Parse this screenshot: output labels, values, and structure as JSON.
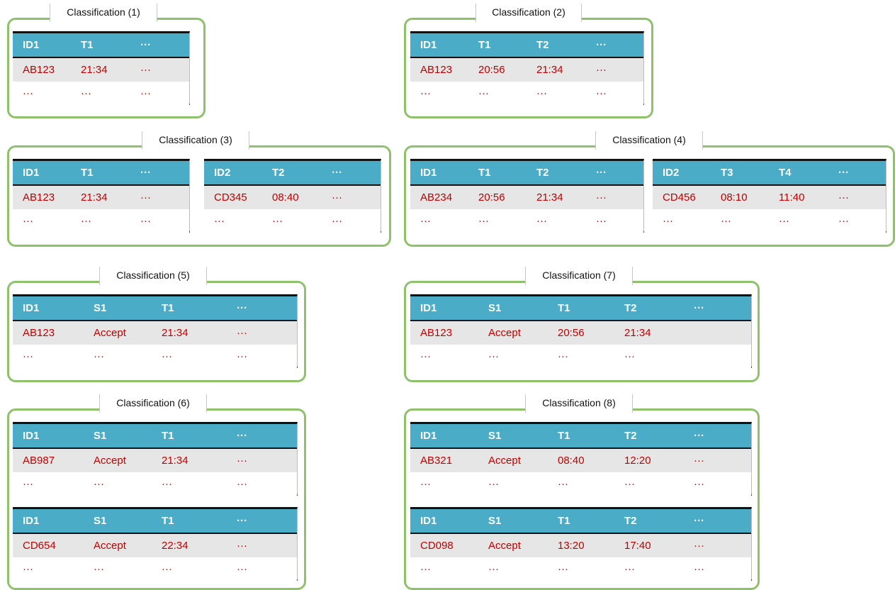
{
  "classifications": [
    {
      "title": "Classification (1)",
      "tables": [
        {
          "headers": [
            "ID1",
            "T1",
            "···"
          ],
          "rows": [
            [
              "AB123",
              "21:34",
              "···"
            ],
            [
              "···",
              "···",
              "···"
            ]
          ]
        }
      ]
    },
    {
      "title": "Classification (2)",
      "tables": [
        {
          "headers": [
            "ID1",
            "T1",
            "T2",
            "···"
          ],
          "rows": [
            [
              "AB123",
              "20:56",
              "21:34",
              "···"
            ],
            [
              "···",
              "···",
              "···",
              "···"
            ]
          ]
        }
      ]
    },
    {
      "title": "Classification (3)",
      "tables": [
        {
          "headers": [
            "ID1",
            "T1",
            "···"
          ],
          "rows": [
            [
              "AB123",
              "21:34",
              "···"
            ],
            [
              "···",
              "···",
              "···"
            ]
          ]
        },
        {
          "headers": [
            "ID2",
            "T2",
            "···"
          ],
          "rows": [
            [
              "CD345",
              "08:40",
              "···"
            ],
            [
              "···",
              "···",
              "···"
            ]
          ]
        }
      ]
    },
    {
      "title": "Classification (4)",
      "tables": [
        {
          "headers": [
            "ID1",
            "T1",
            "T2",
            "···"
          ],
          "rows": [
            [
              "AB234",
              "20:56",
              "21:34",
              "···"
            ],
            [
              "···",
              "···",
              "···",
              "···"
            ]
          ]
        },
        {
          "headers": [
            "ID2",
            "T3",
            "T4",
            "···"
          ],
          "rows": [
            [
              "CD456",
              "08:10",
              "11:40",
              "···"
            ],
            [
              "···",
              "···",
              "···",
              "···"
            ]
          ]
        }
      ]
    },
    {
      "title": "Classification (5)",
      "tables": [
        {
          "headers": [
            "ID1",
            "S1",
            "T1",
            "···"
          ],
          "rows": [
            [
              "AB123",
              "Accept",
              "21:34",
              "···"
            ],
            [
              "···",
              "···",
              "···",
              "···"
            ]
          ]
        }
      ]
    },
    {
      "title": "Classification (7)",
      "tables": [
        {
          "headers": [
            "ID1",
            "S1",
            "T1",
            "T2",
            "···"
          ],
          "rows": [
            [
              "AB123",
              "Accept",
              "20:56",
              "21:34",
              ""
            ],
            [
              "···",
              "···",
              "···",
              "···",
              ""
            ]
          ]
        }
      ]
    },
    {
      "title": "Classification (6)",
      "tables": [
        {
          "headers": [
            "ID1",
            "S1",
            "T1",
            "···"
          ],
          "rows": [
            [
              "AB987",
              "Accept",
              "21:34",
              "···"
            ],
            [
              "···",
              "···",
              "···",
              "···"
            ]
          ]
        },
        {
          "headers": [
            "ID1",
            "S1",
            "T1",
            "···"
          ],
          "rows": [
            [
              "CD654",
              "Accept",
              "22:34",
              "···"
            ],
            [
              "···",
              "···",
              "···",
              "···"
            ]
          ]
        }
      ]
    },
    {
      "title": "Classification (8)",
      "tables": [
        {
          "headers": [
            "ID1",
            "S1",
            "T1",
            "T2",
            "···"
          ],
          "rows": [
            [
              "AB321",
              "Accept",
              "08:40",
              "12:20",
              "···"
            ],
            [
              "···",
              "···",
              "···",
              "···",
              "···"
            ]
          ]
        },
        {
          "headers": [
            "ID1",
            "S1",
            "T1",
            "T2",
            "···"
          ],
          "rows": [
            [
              "CD098",
              "Accept",
              "13:20",
              "17:40",
              "···"
            ],
            [
              "···",
              "···",
              "···",
              "···",
              "···"
            ]
          ]
        }
      ]
    }
  ]
}
